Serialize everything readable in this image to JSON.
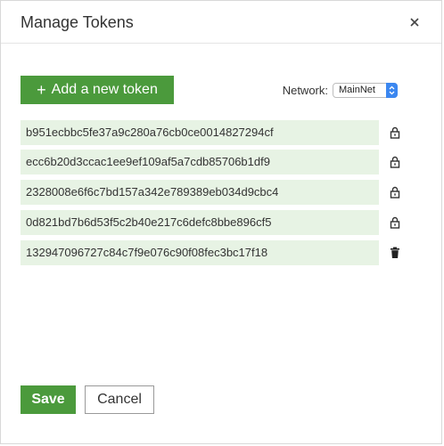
{
  "dialog": {
    "title": "Manage Tokens",
    "close_icon": "close-icon"
  },
  "toolbar": {
    "add_plus": "+",
    "add_label": "Add a new token",
    "network_label": "Network:",
    "network_value": "MainNet"
  },
  "tokens": [
    {
      "value": "b951ecbbc5fe37a9c280a76cb0ce0014827294cf",
      "icon": "lock-icon"
    },
    {
      "value": "ecc6b20d3ccac1ee9ef109af5a7cdb85706b1df9",
      "icon": "lock-icon"
    },
    {
      "value": "2328008e6f6c7bd157a342e789389eb034d9cbc4",
      "icon": "lock-icon"
    },
    {
      "value": "0d821bd7b6d53f5c2b40e217c6defc8bbe896cf5",
      "icon": "lock-icon"
    },
    {
      "value": "132947096727c84c7f9e076c90f08fec3bc17f18",
      "icon": "trash-icon"
    }
  ],
  "footer": {
    "save_label": "Save",
    "cancel_label": "Cancel"
  },
  "colors": {
    "accent_green": "#4b9a3c",
    "token_bg": "#e7f3e4",
    "select_blue": "#3b87f0"
  }
}
